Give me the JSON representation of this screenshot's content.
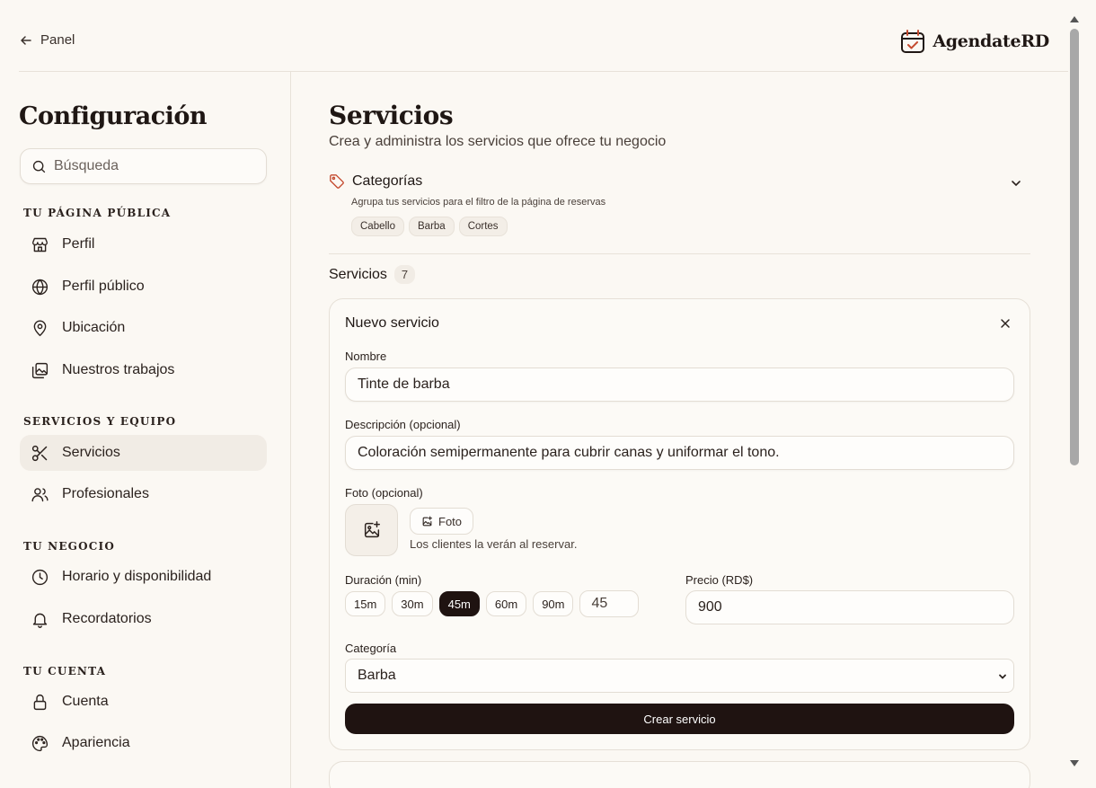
{
  "topbar": {
    "back_label": "Panel",
    "brand_name": "AgendateRD",
    "brand_color": "#c44a2f"
  },
  "sidebar": {
    "title": "Configuración",
    "search_placeholder": "Búsqueda",
    "sections": [
      {
        "label": "Tu página pública",
        "items": [
          {
            "label": "Perfil",
            "icon": "store-icon"
          },
          {
            "label": "Perfil público",
            "icon": "globe-icon"
          },
          {
            "label": "Ubicación",
            "icon": "map-pin-icon"
          },
          {
            "label": "Nuestros trabajos",
            "icon": "images-icon"
          }
        ]
      },
      {
        "label": "Servicios y equipo",
        "items": [
          {
            "label": "Servicios",
            "icon": "scissors-icon",
            "active": true
          },
          {
            "label": "Profesionales",
            "icon": "users-icon"
          }
        ]
      },
      {
        "label": "Tu negocio",
        "items": [
          {
            "label": "Horario y disponibilidad",
            "icon": "clock-icon"
          },
          {
            "label": "Recordatorios",
            "icon": "bell-icon"
          }
        ]
      },
      {
        "label": "Tu cuenta",
        "items": [
          {
            "label": "Cuenta",
            "icon": "lock-icon"
          },
          {
            "label": "Apariencia",
            "icon": "palette-icon"
          }
        ]
      }
    ]
  },
  "main": {
    "title": "Servicios",
    "subtitle": "Crea y administra los servicios que ofrece tu negocio",
    "categories": {
      "title": "Categorías",
      "description": "Agrupa tus servicios para el filtro de la página de reservas",
      "chips": [
        "Cabello",
        "Barba",
        "Cortes"
      ]
    },
    "services_label": "Servicios",
    "services_count": "7",
    "form": {
      "title": "Nuevo servicio",
      "name_label": "Nombre",
      "name_value": "Tinte de barba",
      "desc_label": "Descripción (opcional)",
      "desc_value": "Coloración semipermanente para cubrir canas y uniformar el tono.",
      "photo_label": "Foto (opcional)",
      "photo_button": "Foto",
      "photo_hint": "Los clientes la verán al reservar.",
      "duration_label": "Duración (min)",
      "durations": [
        "15m",
        "30m",
        "45m",
        "60m",
        "90m"
      ],
      "duration_selected": "45m",
      "duration_value": "45",
      "price_label": "Precio (RD$)",
      "price_value": "900",
      "category_label": "Categoría",
      "category_value": "Barba",
      "submit_label": "Crear servicio"
    }
  }
}
